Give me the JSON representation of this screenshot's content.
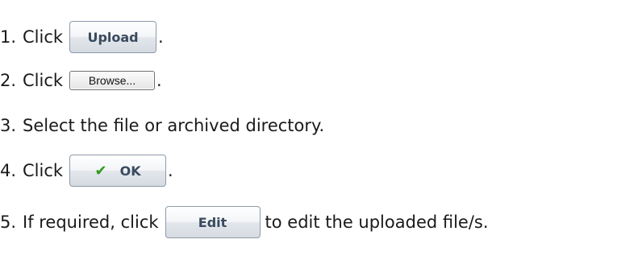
{
  "steps": [
    {
      "number": "1.",
      "text": "Click",
      "button": "Upload",
      "after": "."
    },
    {
      "number": "2.",
      "text": "Click",
      "button": "Browse...",
      "after": "."
    },
    {
      "number": "3.",
      "text": "Select the file or archived directory."
    },
    {
      "number": "4.",
      "text": "Click",
      "button": "OK",
      "button_icon": "check-icon",
      "after": "."
    },
    {
      "number": "5.",
      "text": "If required, click",
      "button": "Edit",
      "after": "to edit the uploaded file/s."
    }
  ],
  "colors": {
    "text": "#1a1a1a",
    "button_text": "#3a4a5e",
    "check": "#2f9a1f"
  }
}
